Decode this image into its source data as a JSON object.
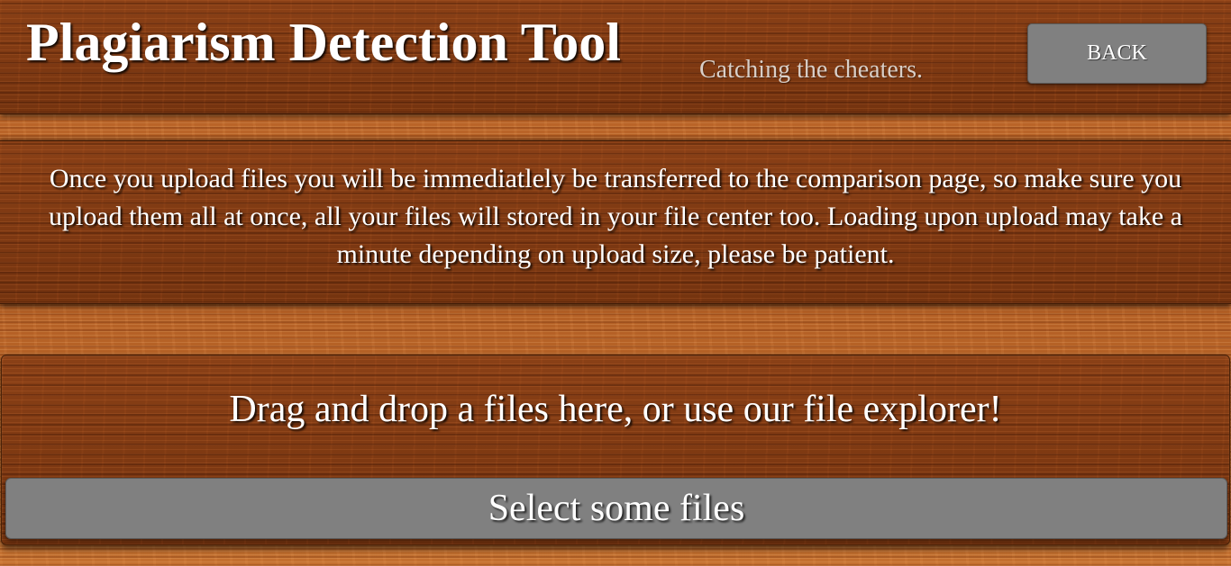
{
  "header": {
    "title": "Plagiarism Detection Tool",
    "tagline": "Catching the cheaters.",
    "back_label": "BACK"
  },
  "info": {
    "text": "Once you upload files you will be immediatlely be transferred to the comparison page, so make sure you upload them all at once, all your files will stored in your file center too. Loading upon upload may take a minute depending on upload size, please be patient."
  },
  "dropzone": {
    "prompt": "Drag and drop a files here, or use our file explorer!",
    "select_label": "Select some files"
  },
  "colors": {
    "button_gray": "#808080",
    "panel_wood_dark": "#7a3712",
    "background_wood_light": "#b9652a",
    "text_white": "#ffffff",
    "tagline_gray": "#d9cfc8"
  }
}
